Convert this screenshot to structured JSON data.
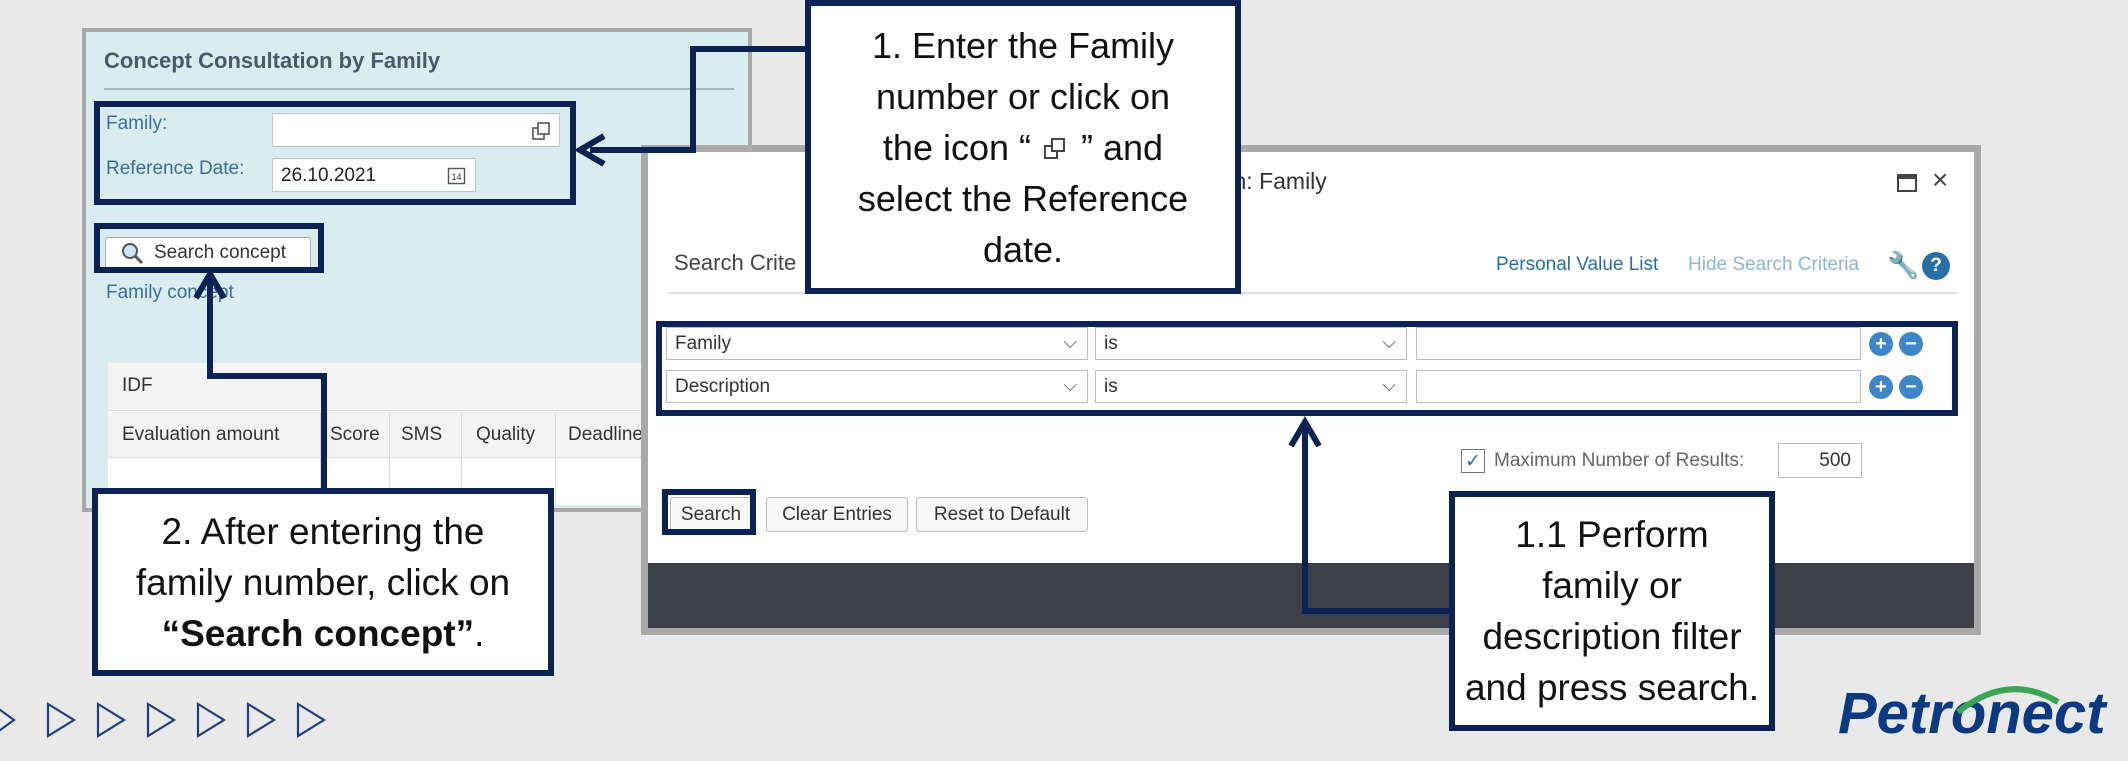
{
  "left_panel": {
    "title": "Concept Consultation by Family",
    "family_label": "Family:",
    "reference_date_label": "Reference Date:",
    "reference_date_value": "26.10.2021",
    "search_concept_button": "Search concept",
    "family_concept_link": "Family concept",
    "table": {
      "group_header": "IDF",
      "columns": [
        "Evaluation amount",
        "Score",
        "SMS",
        "Quality",
        "Deadline"
      ]
    }
  },
  "dialog": {
    "title": "Search: Family",
    "title_visible": "ch: Family",
    "search_criteria_label": "Search Crite",
    "personal_value_list": "Personal Value List",
    "hide_search_criteria": "Hide Search Criteria",
    "rows": [
      {
        "field": "Family",
        "operator": "is",
        "value": ""
      },
      {
        "field": "Description",
        "operator": "is",
        "value": ""
      }
    ],
    "max_results_label": "Maximum Number of Results:",
    "max_results_value": "500",
    "buttons": {
      "search": "Search",
      "clear": "Clear Entries",
      "reset": "Reset to Default"
    }
  },
  "callouts": {
    "c1": [
      "1. Enter the Family",
      "number or click on",
      "the icon “  ” and",
      "select the Reference",
      "date."
    ],
    "c2_lines": [
      "2. After entering the",
      "family number, click on"
    ],
    "c2_bold": "“Search concept”",
    "c2_end": ".",
    "c3": [
      "1.1 Perform",
      "family or",
      "description filter",
      "and press search."
    ]
  },
  "brand": {
    "logo_text": "Petronect",
    "accent_color": "#0b2354",
    "logo_color": "#0b3a82"
  },
  "icons": [
    "value-help-icon",
    "calendar-icon",
    "search-magnifier-icon",
    "maximize-icon",
    "close-icon",
    "wrench-icon",
    "help-icon",
    "plus-icon",
    "minus-icon",
    "checkbox-checked-icon",
    "play-arrow-icon"
  ]
}
